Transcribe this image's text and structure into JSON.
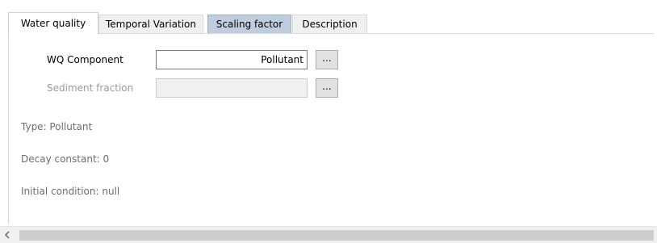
{
  "tabs": [
    {
      "label": "Water quality",
      "state": "active"
    },
    {
      "label": "Temporal Variation",
      "state": "normal"
    },
    {
      "label": "Scaling factor",
      "state": "highlighted"
    },
    {
      "label": "Description",
      "state": "normal"
    }
  ],
  "form": {
    "wq_component_label": "WQ Component",
    "wq_component_value": "Pollutant",
    "sediment_fraction_label": "Sediment fraction",
    "sediment_fraction_value": "",
    "browse_button_label": "..."
  },
  "info": {
    "type": "Type: Pollutant",
    "decay_constant": "Decay constant: 0",
    "initial_condition": "Initial condition: null"
  },
  "scrollbar": {
    "left_arrow_icon": "chevron-left-icon"
  },
  "colors": {
    "active_tab": "#ffffff",
    "highlighted_tab": "#bfcedd",
    "inactive_tab": "#f0f0f0"
  }
}
